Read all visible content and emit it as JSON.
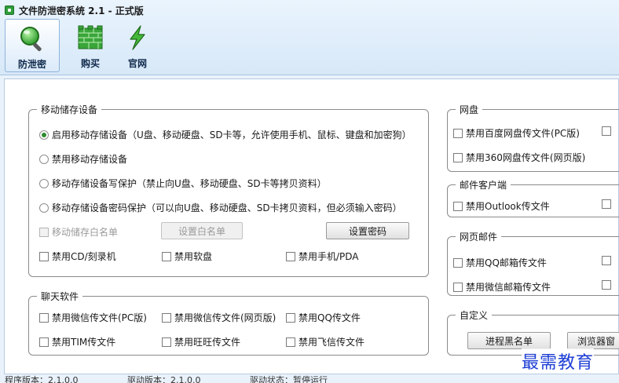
{
  "window": {
    "title": "文件防泄密系统 2.1 - 正式版"
  },
  "toolbar": {
    "items": [
      {
        "label": "防泄密"
      },
      {
        "label": "购买"
      },
      {
        "label": "官网"
      }
    ]
  },
  "usb": {
    "legend": "移动储存设备",
    "radio_1": "启用移动存储设备（U盘、移动硬盘、SD卡等，允许使用手机、鼠标、键盘和加密狗）",
    "radio_2": "禁用移动存储设备",
    "radio_3": "移动存储设备写保护（禁止向U盘、移动硬盘、SD卡等拷贝资料）",
    "radio_4": "移动存储设备密码保护（可以向U盘、移动硬盘、SD卡拷贝资料，但必须输入密码）",
    "whitelist_label": "移动储存白名单",
    "whitelist_button": "设置白名单",
    "password_button": "设置密码",
    "cd": "禁用CD/刻录机",
    "floppy": "禁用软盘",
    "phone": "禁用手机/PDA"
  },
  "chat": {
    "legend": "聊天软件",
    "wechat_pc": "禁用微信传文件(PC版)",
    "wechat_web": "禁用微信传文件(网页版)",
    "qq": "禁用QQ传文件",
    "tim": "禁用TIM传文件",
    "wangwang": "禁用旺旺传文件",
    "fetion": "禁用飞信传文件"
  },
  "netdisk": {
    "legend": "网盘",
    "baidu": "禁用百度网盘传文件(PC版)",
    "n360": "禁用360网盘传文件(网页版)"
  },
  "mail_client": {
    "legend": "邮件客户端",
    "outlook": "禁用Outlook传文件"
  },
  "webmail": {
    "legend": "网页邮件",
    "qq_mail": "禁用QQ邮箱传文件",
    "wei_mail": "禁用微信邮箱传文件"
  },
  "custom": {
    "legend": "自定义",
    "blacklist_button": "进程黑名单",
    "browser_button": "浏览器窗"
  },
  "status": {
    "program_version": "程序版本：2.1.0.0",
    "driver_version": "驱动版本：2.1.0.0",
    "driver_status": "驱动状态：暂停运行"
  },
  "watermark": "最需教育"
}
